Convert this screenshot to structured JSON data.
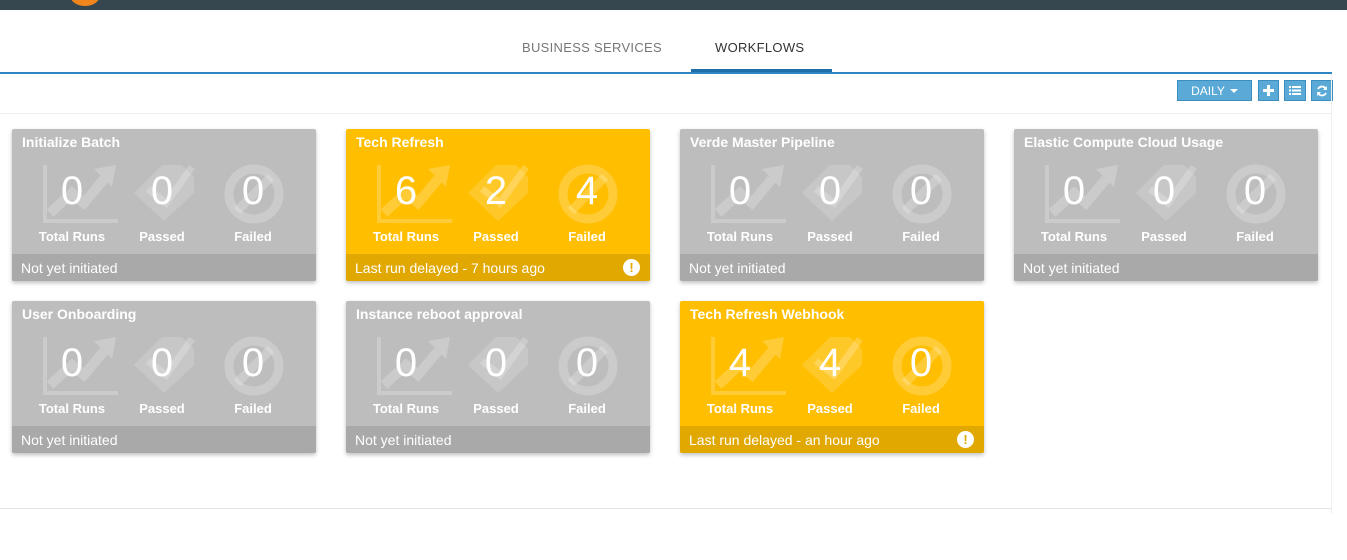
{
  "tabs": [
    {
      "label": "BUSINESS SERVICES"
    },
    {
      "label": "WORKFLOWS"
    }
  ],
  "active_tab": "WORKFLOWS",
  "toolbar": {
    "period_label": "DAILY",
    "period_caret_icon": "caret-down-icon",
    "add_icon": "plus-icon",
    "list_icon": "list-icon",
    "refresh_icon": "refresh-icon",
    "button_color": "#5aa9d6"
  },
  "colors": {
    "inactive_card": "#bdbdbd",
    "delayed_card": "#ffbe00",
    "accent": "#2f86c1"
  },
  "stat_labels": {
    "runs": "Total Runs",
    "passed": "Passed",
    "failed": "Failed"
  },
  "workflows": [
    {
      "title": "Initialize Batch",
      "status": "inactive",
      "total_runs": "0",
      "passed": "0",
      "failed": "0",
      "footer": "Not yet initiated",
      "warning": false
    },
    {
      "title": "Tech Refresh",
      "status": "delayed",
      "total_runs": "6",
      "passed": "2",
      "failed": "4",
      "footer": "Last run delayed - 7 hours ago",
      "warning": true
    },
    {
      "title": "Verde Master Pipeline",
      "status": "inactive",
      "total_runs": "0",
      "passed": "0",
      "failed": "0",
      "footer": "Not yet initiated",
      "warning": false
    },
    {
      "title": "Elastic Compute Cloud Usage",
      "status": "inactive",
      "total_runs": "0",
      "passed": "0",
      "failed": "0",
      "footer": "Not yet initiated",
      "warning": false
    },
    {
      "title": "User Onboarding",
      "status": "inactive",
      "total_runs": "0",
      "passed": "0",
      "failed": "0",
      "footer": "Not yet initiated",
      "warning": false
    },
    {
      "title": "Instance reboot approval",
      "status": "inactive",
      "total_runs": "0",
      "passed": "0",
      "failed": "0",
      "footer": "Not yet initiated",
      "warning": false
    },
    {
      "title": "Tech Refresh Webhook",
      "status": "delayed",
      "total_runs": "4",
      "passed": "4",
      "failed": "0",
      "footer": "Last run delayed - an hour ago",
      "warning": true
    }
  ]
}
